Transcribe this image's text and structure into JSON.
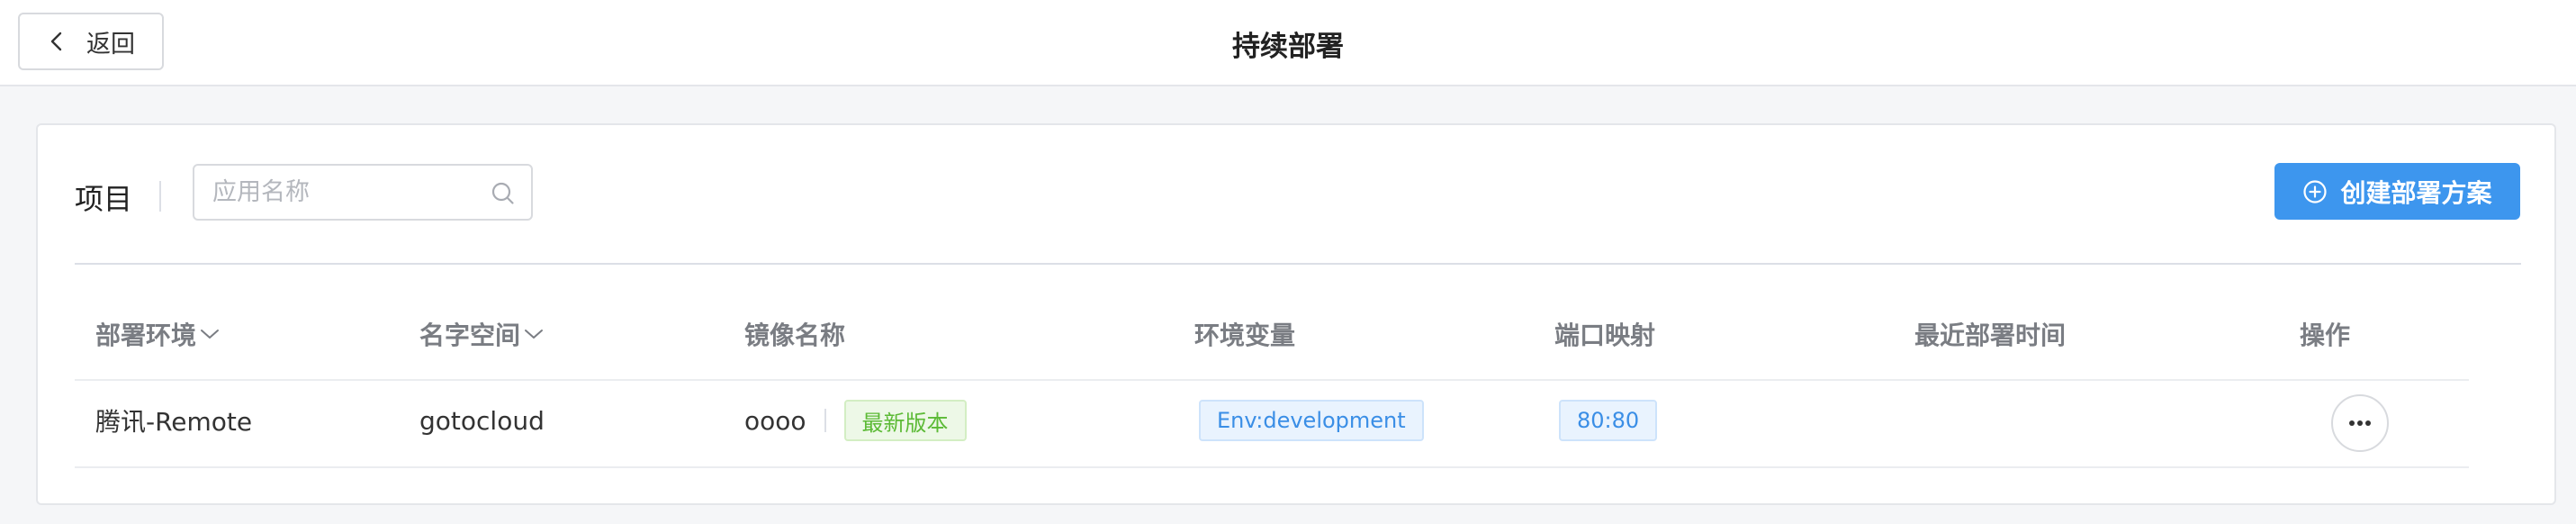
{
  "header": {
    "back_label": "返回",
    "title": "持续部署"
  },
  "toolbar": {
    "section_label": "项目",
    "search": {
      "placeholder": "应用名称",
      "value": ""
    },
    "create_label": "创建部署方案"
  },
  "table": {
    "columns": [
      "部署环境",
      "名字空间",
      "镜像名称",
      "环境变量",
      "端口映射",
      "最近部署时间",
      "操作"
    ],
    "rows": [
      {
        "environment": "腾讯-Remote",
        "namespace": "gotocloud",
        "image": "oooo",
        "image_tag": "最新版本",
        "env_vars": "Env:development",
        "ports": "80:80",
        "last_deploy": ""
      }
    ]
  },
  "colors": {
    "primary": "#3d96ee",
    "tag_green": "#5cba36",
    "tag_blue": "#3a8ee6"
  },
  "icons": [
    "chevron-left-icon",
    "search-icon",
    "plus-circle-icon",
    "chevron-down-icon",
    "more-horizontal-icon"
  ]
}
